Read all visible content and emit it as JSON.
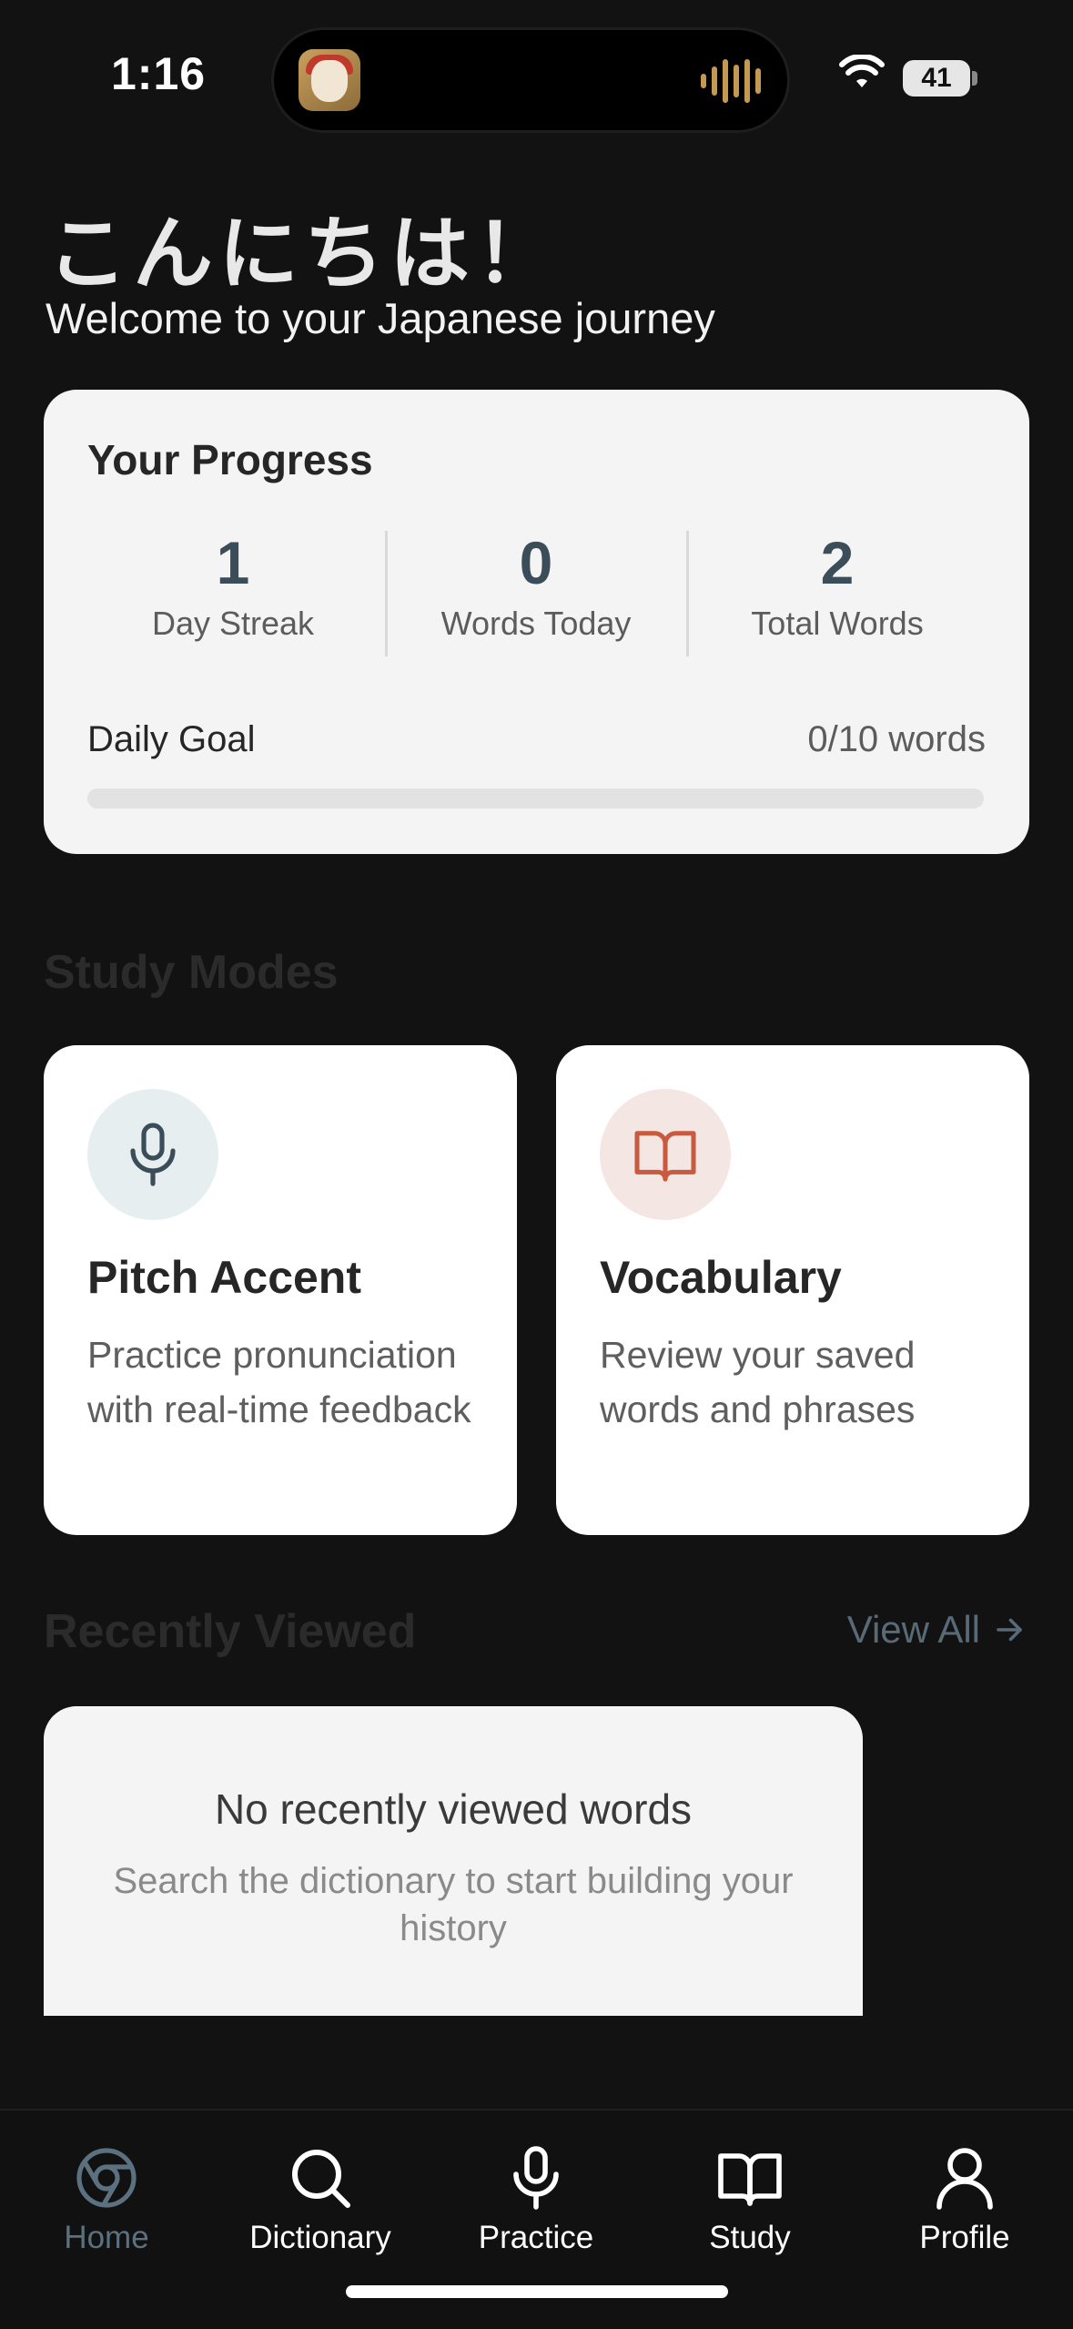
{
  "status_bar": {
    "time": "1:16",
    "battery": "41",
    "icons": [
      "wifi-icon",
      "battery-icon",
      "audio-waveform-icon"
    ]
  },
  "header": {
    "greeting": "こんにちは！",
    "subtitle": "Welcome to your Japanese journey"
  },
  "progress": {
    "title": "Your Progress",
    "stats": [
      {
        "value": "1",
        "label": "Day Streak"
      },
      {
        "value": "0",
        "label": "Words Today"
      },
      {
        "value": "2",
        "label": "Total Words"
      }
    ],
    "daily_goal_label": "Daily Goal",
    "daily_goal_value": "0/10 words",
    "daily_goal_fraction": 0
  },
  "study_modes": {
    "title": "Study Modes",
    "cards": [
      {
        "title": "Pitch Accent",
        "description": "Practice pronunciation with real-time feedback",
        "icon": "microphone-icon",
        "accent": "#3c4d5a"
      },
      {
        "title": "Vocabulary",
        "description": "Review your saved words and phrases",
        "icon": "book-icon",
        "accent": "#c85a40"
      }
    ]
  },
  "recent": {
    "title": "Recently Viewed",
    "view_all": "View All",
    "empty_title": "No recently viewed words",
    "empty_description": "Search the dictionary to start building your history"
  },
  "tabs": [
    {
      "label": "Home",
      "icon": "home-icon",
      "active": true
    },
    {
      "label": "Dictionary",
      "icon": "search-icon",
      "active": false
    },
    {
      "label": "Practice",
      "icon": "microphone-icon",
      "active": false
    },
    {
      "label": "Study",
      "icon": "book-icon",
      "active": false
    },
    {
      "label": "Profile",
      "icon": "person-icon",
      "active": false
    }
  ],
  "colors": {
    "background": "#121212",
    "accent": "#5c7180",
    "stat": "#3c4d5a",
    "vocab": "#c85a40"
  }
}
